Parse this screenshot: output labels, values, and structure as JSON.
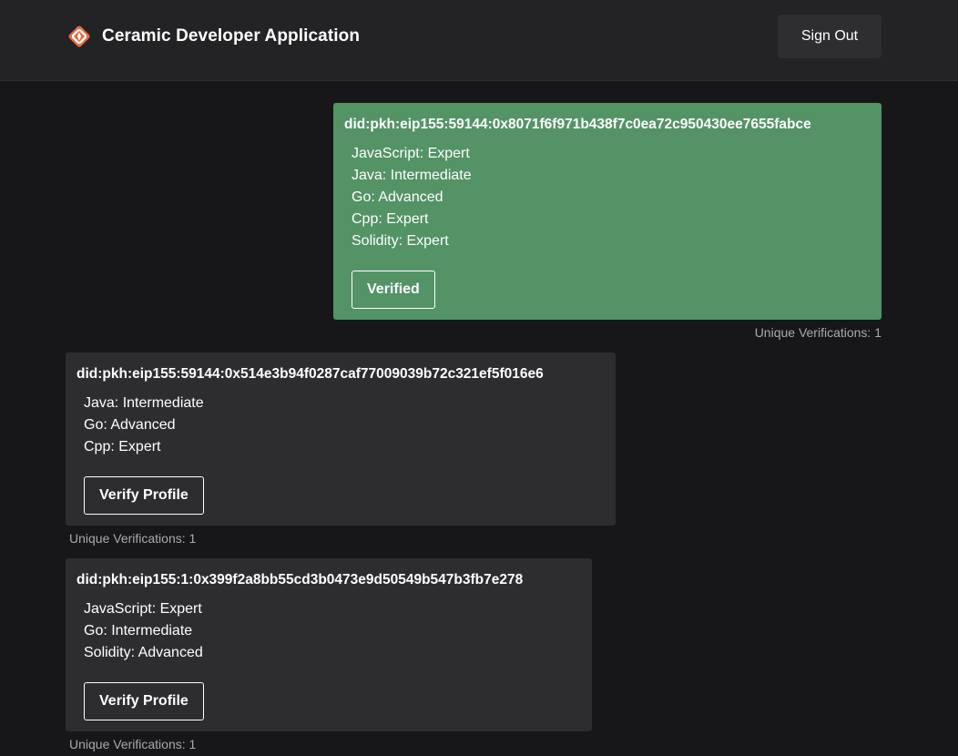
{
  "header": {
    "app_title": "Ceramic Developer Application",
    "logo_icon": "ceramic-logo-icon",
    "sign_out_label": "Sign Out"
  },
  "profiles": [
    {
      "did": "did:pkh:eip155:59144:0x8071f6f971b438f7c0ea72c950430ee7655fabce",
      "skills": [
        "JavaScript: Expert",
        "Java: Intermediate",
        "Go: Advanced",
        "Cpp: Expert",
        "Solidity: Expert"
      ],
      "button_label": "Verified",
      "verifications": "Unique Verifications: 1",
      "status_color": "#539366"
    },
    {
      "did": "did:pkh:eip155:59144:0x514e3b94f0287caf77009039b72c321ef5f016e6",
      "skills": [
        "Java: Intermediate",
        "Go: Advanced",
        "Cpp: Expert"
      ],
      "button_label": "Verify Profile",
      "verifications": "Unique Verifications: 1"
    },
    {
      "did": "did:pkh:eip155:1:0x399f2a8bb55cd3b0473e9d50549b547b3fb7e278",
      "skills": [
        "JavaScript: Expert",
        "Go: Intermediate",
        "Solidity: Advanced"
      ],
      "button_label": "Verify Profile",
      "verifications": "Unique Verifications: 1"
    }
  ],
  "colors": {
    "background": "#17171a",
    "header": "#232325",
    "card": "#2d2d30",
    "verified_card": "#539366",
    "logo_orange": "#f2653a"
  }
}
